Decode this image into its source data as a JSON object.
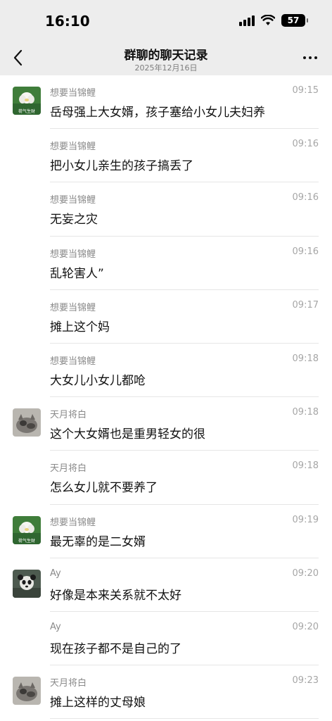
{
  "status_bar": {
    "time": "16:10",
    "battery": "57",
    "signal_icon": "signal-bars-icon",
    "wifi_icon": "wifi-icon"
  },
  "header": {
    "title": "群聊的聊天记录",
    "subtitle": "2025年12月16日",
    "back_icon": "chevron-left-icon",
    "more_icon": "more-dots-icon"
  },
  "messages": [
    {
      "sender": "想要当锦鲤",
      "time": "09:15",
      "text": "岳母强上大女婿，孩子塞给小女儿夫妇养",
      "avatar": "lotus",
      "avatar_text": "荷气生财"
    },
    {
      "sender": "想要当锦鲤",
      "time": "09:16",
      "text": "把小女儿亲生的孩子搞丢了",
      "avatar": ""
    },
    {
      "sender": "想要当锦鲤",
      "time": "09:16",
      "text": "无妄之灾",
      "avatar": ""
    },
    {
      "sender": "想要当锦鲤",
      "time": "09:16",
      "text": "乱轮害人”",
      "avatar": ""
    },
    {
      "sender": "想要当锦鲤",
      "time": "09:17",
      "text": "摊上这个妈",
      "avatar": ""
    },
    {
      "sender": "想要当锦鲤",
      "time": "09:18",
      "text": "大女儿小女儿都呛",
      "avatar": ""
    },
    {
      "sender": "天月将白",
      "time": "09:18",
      "text": "这个大女婿也是重男轻女的很",
      "avatar": "cat"
    },
    {
      "sender": "天月将白",
      "time": "09:18",
      "text": "怎么女儿就不要养了",
      "avatar": ""
    },
    {
      "sender": "想要当锦鲤",
      "time": "09:19",
      "text": "最无辜的是二女婿",
      "avatar": "lotus",
      "avatar_text": "荷气生财"
    },
    {
      "sender": "Ay",
      "time": "09:20",
      "text": "好像是本来关系就不太好",
      "avatar": "panda"
    },
    {
      "sender": "Ay",
      "time": "09:20",
      "text": "现在孩子都不是自己的了",
      "avatar": ""
    },
    {
      "sender": "天月将白",
      "time": "09:23",
      "text": "摊上这样的丈母娘",
      "avatar": "cat"
    }
  ]
}
